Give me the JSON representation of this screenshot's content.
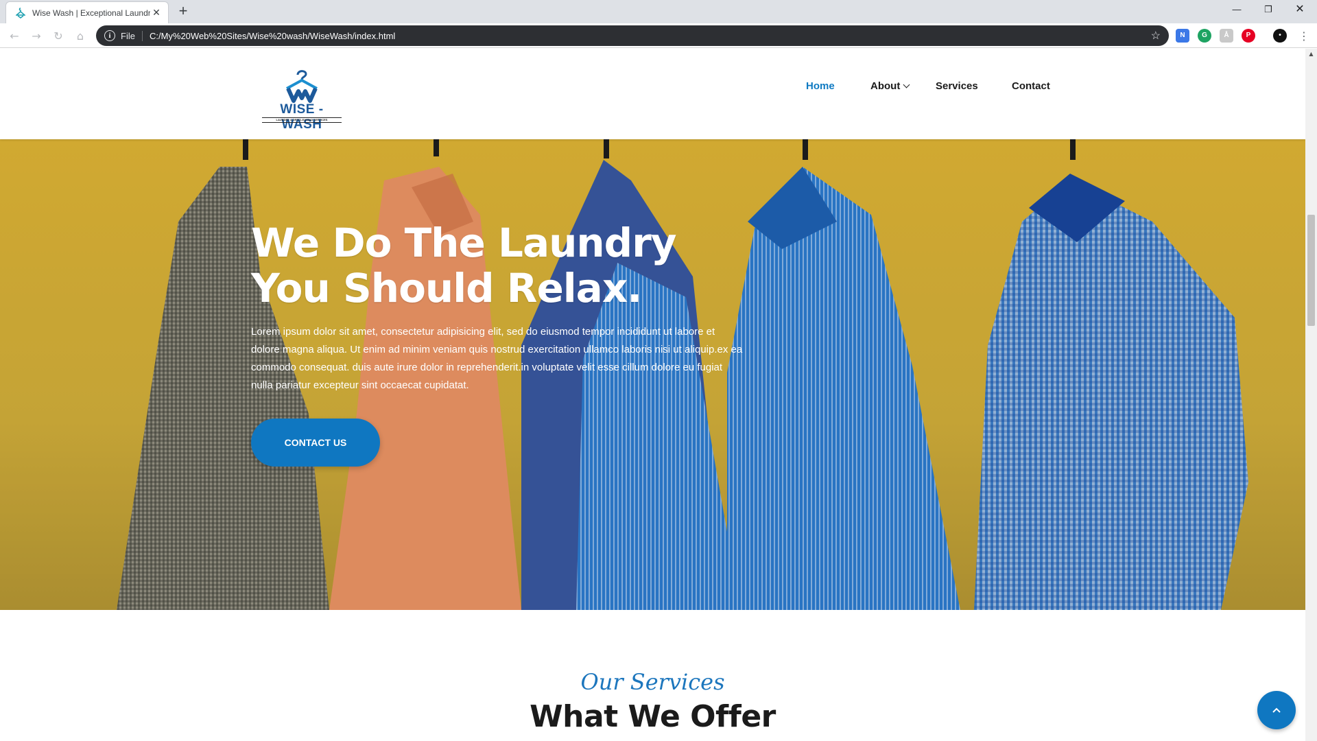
{
  "browser": {
    "tab_title": "Wise Wash | Exceptional Laundry",
    "new_tab": "+",
    "url_scheme": "File",
    "url": "C:/My%20Web%20Sites/Wise%20wash/WiseWash/index.html"
  },
  "header": {
    "logo_word": "WISE - WASH",
    "logo_tag": "LAUNDRY & DRYCLEANING SERVICES",
    "nav": [
      {
        "label": "Home"
      },
      {
        "label": "About"
      },
      {
        "label": "Services"
      },
      {
        "label": "Contact"
      }
    ]
  },
  "hero": {
    "title_line1": "We Do The Laundry",
    "title_line2": "You Should Relax.",
    "text": "Lorem ipsum dolor sit amet, consectetur adipisicing elit, sed do eiusmod tempor incididunt ut labore et dolore magna aliqua. Ut enim ad minim veniam quis nostrud exercitation ullamco laboris nisi ut aliquip.ex ea commodo consequat. duis aute irure dolor in reprehenderit.in voluptate velit esse cillum dolore eu fugiat nulla pariatur excepteur sint occaecat cupidatat.",
    "cta_label": "CONTACT US"
  },
  "services": {
    "script_title": "Our Services",
    "title": "What We Offer"
  },
  "colors": {
    "brand_blue": "#0f77c1",
    "hero_yellow": "#e1b838"
  }
}
